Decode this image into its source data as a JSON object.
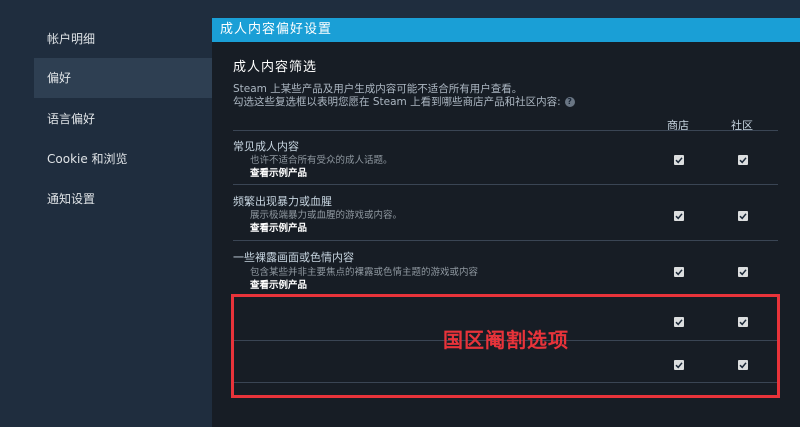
{
  "sidebar": {
    "items": [
      {
        "label": "帐户明细"
      },
      {
        "label": "偏好"
      },
      {
        "label": "语言偏好"
      },
      {
        "label": "Cookie 和浏览"
      },
      {
        "label": "通知设置"
      }
    ]
  },
  "panel": {
    "header": "成人内容偏好设置",
    "section_title": "成人内容筛选",
    "description_line1": "Steam 上某些产品及用户生成内容可能不适合所有用户查看。",
    "description_line2": "勾选这些复选框以表明您愿在 Steam 上看到哪些商店产品和社区内容:",
    "help_icon": "?",
    "columns": {
      "store": "商店",
      "community": "社区"
    },
    "rows": [
      {
        "title": "常见成人内容",
        "subtitle": "也许不适合所有受众的成人话题。",
        "link": "查看示例产品",
        "store_checked": true,
        "community_checked": true
      },
      {
        "title": "频繁出现暴力或血腥",
        "subtitle": "展示极端暴力或血腥的游戏或内容。",
        "link": "查看示例产品",
        "store_checked": true,
        "community_checked": true
      },
      {
        "title": "一些裸露画面或色情内容",
        "subtitle": "包含某些并非主要焦点的裸露或色情主题的游戏或内容",
        "link": "查看示例产品",
        "store_checked": true,
        "community_checked": true
      },
      {
        "title": "",
        "subtitle": "",
        "link": "",
        "store_checked": true,
        "community_checked": true
      },
      {
        "title": "",
        "subtitle": "",
        "link": "",
        "store_checked": true,
        "community_checked": true
      }
    ]
  },
  "annotation": {
    "text": "国区阉割选项",
    "color": "#e8333a"
  },
  "colors": {
    "header_bg": "#1a9fd6",
    "panel_bg": "#171d25",
    "sidebar_bg": "#1f2d3e",
    "sidebar_active_bg": "#2e3f52"
  }
}
